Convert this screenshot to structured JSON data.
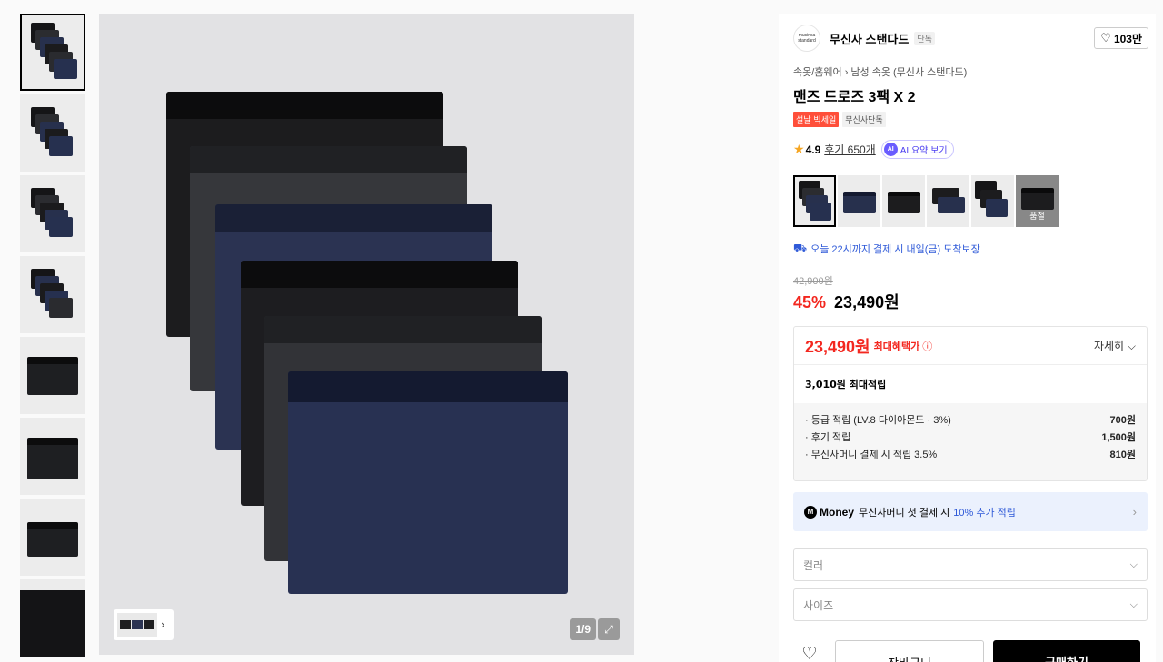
{
  "gallery": {
    "thumbnails": [
      "pack-stack",
      "pack-stack-label",
      "pack-stack-label",
      "pack-stack-label",
      "single-front",
      "single-side",
      "single-back",
      "fabric-detail"
    ],
    "nav_chevron": "›",
    "counter": "1/9",
    "expand_icon": "expand-icon"
  },
  "product": {
    "brand_logo_text": "musinsa standard",
    "brand_name": "무신사 스탠다드",
    "brand_badge": "단독",
    "like_icon": "♡",
    "like_count": "103만",
    "breadcrumb": "속옷/홈웨어 › 남성 속옷 (무신사 스탠다드)",
    "title": "맨즈 드로즈 3팩 X 2",
    "tags": {
      "sale": "설날 빅세일",
      "exclusive": "무신사단독"
    },
    "rating": {
      "star": "★",
      "score": "4.9",
      "reviews": "후기 650개",
      "ai_icon": "AI",
      "ai_label": "AI 요약 보기"
    },
    "options": {
      "soldout_label": "품절"
    },
    "delivery": {
      "icon": "⛟",
      "text": "오늘 22시까지 결제 시 내일(금) 도착보장"
    },
    "original_price": "42,900원",
    "discount": "45%",
    "sale_price": "23,490원"
  },
  "benefit": {
    "max_price": "23,490원",
    "max_label": "최대혜택가",
    "info_icon": "ⓘ",
    "detail_label": "자세히 ⌵",
    "points_title": "3,010원 최대적립",
    "points": [
      {
        "label": "· 등급 적립 (LV.8 다이아몬드 · 3%)",
        "value": "700원"
      },
      {
        "label": "· 후기 적립",
        "value": "1,500원"
      },
      {
        "label": "· 무신사머니 결제 시 적립 3.5%",
        "value": "810원"
      }
    ]
  },
  "money_banner": {
    "icon": "M",
    "brand": "Money",
    "text": "무신사머니 첫 결제 시",
    "highlight": "10% 추가 적립",
    "arrow": "›"
  },
  "selects": {
    "color": "컬러",
    "size": "사이즈",
    "chevron": "⌵"
  },
  "actions": {
    "heart": "♡",
    "cart": "장바구니",
    "buy": "구매하기"
  },
  "colors": {
    "accent_red": "#f3271f",
    "link_blue": "#2f5ad8",
    "sale_tag": "#ff4f3a"
  }
}
